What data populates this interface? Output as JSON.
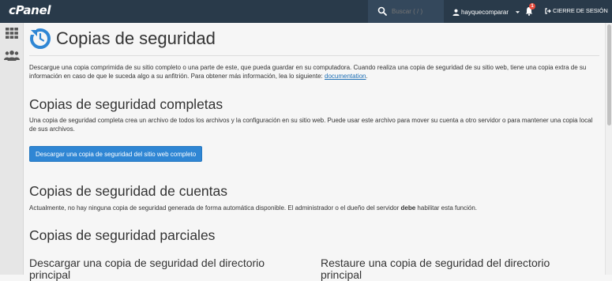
{
  "header": {
    "logo": "cPanel",
    "search_placeholder": "Buscar ( / )",
    "username": "hayquecomparar",
    "notification_count": "1",
    "logout_label": "CIERRE DE SESIÓN"
  },
  "sidebar": {
    "items": [
      {
        "icon": "grid-icon",
        "label": ""
      },
      {
        "icon": "users-icon",
        "label": ""
      }
    ]
  },
  "page": {
    "title": "Copias de seguridad",
    "intro": "Descargue una copia comprimida de su sitio completo o una parte de este, que pueda guardar en su computadora. Cuando realiza una copia de seguridad de su sitio web, tiene una copia extra de su información en caso de que le suceda algo a su anfitrión. Para obtener más información, lea lo siguiente: ",
    "intro_link": "documentation",
    "intro_end": "."
  },
  "full_backup": {
    "heading": "Copias de seguridad completas",
    "description": "Una copia de seguridad completa crea un archivo de todos los archivos y la configuración en su sitio web. Puede usar este archivo para mover su cuenta a otro servidor o para mantener una copia local de sus archivos.",
    "button_label": "Descargar una copia de seguridad del sitio web completo"
  },
  "account_backup": {
    "heading": "Copias de seguridad de cuentas",
    "description_before": "Actualmente, no hay ninguna copia de seguridad generada de forma automática disponible. El administrador o el dueño del servidor ",
    "description_bold": "debe",
    "description_after": " habilitar esta función."
  },
  "partial_backup": {
    "heading": "Copias de seguridad parciales",
    "download_heading": "Descargar una copia de seguridad del directorio principal",
    "restore_heading": "Restaure una copia de seguridad del directorio principal"
  },
  "colors": {
    "topbar": "#293a4a",
    "accent": "#2f86d4",
    "link": "#1e6fb5",
    "badge": "#e84c3d"
  }
}
